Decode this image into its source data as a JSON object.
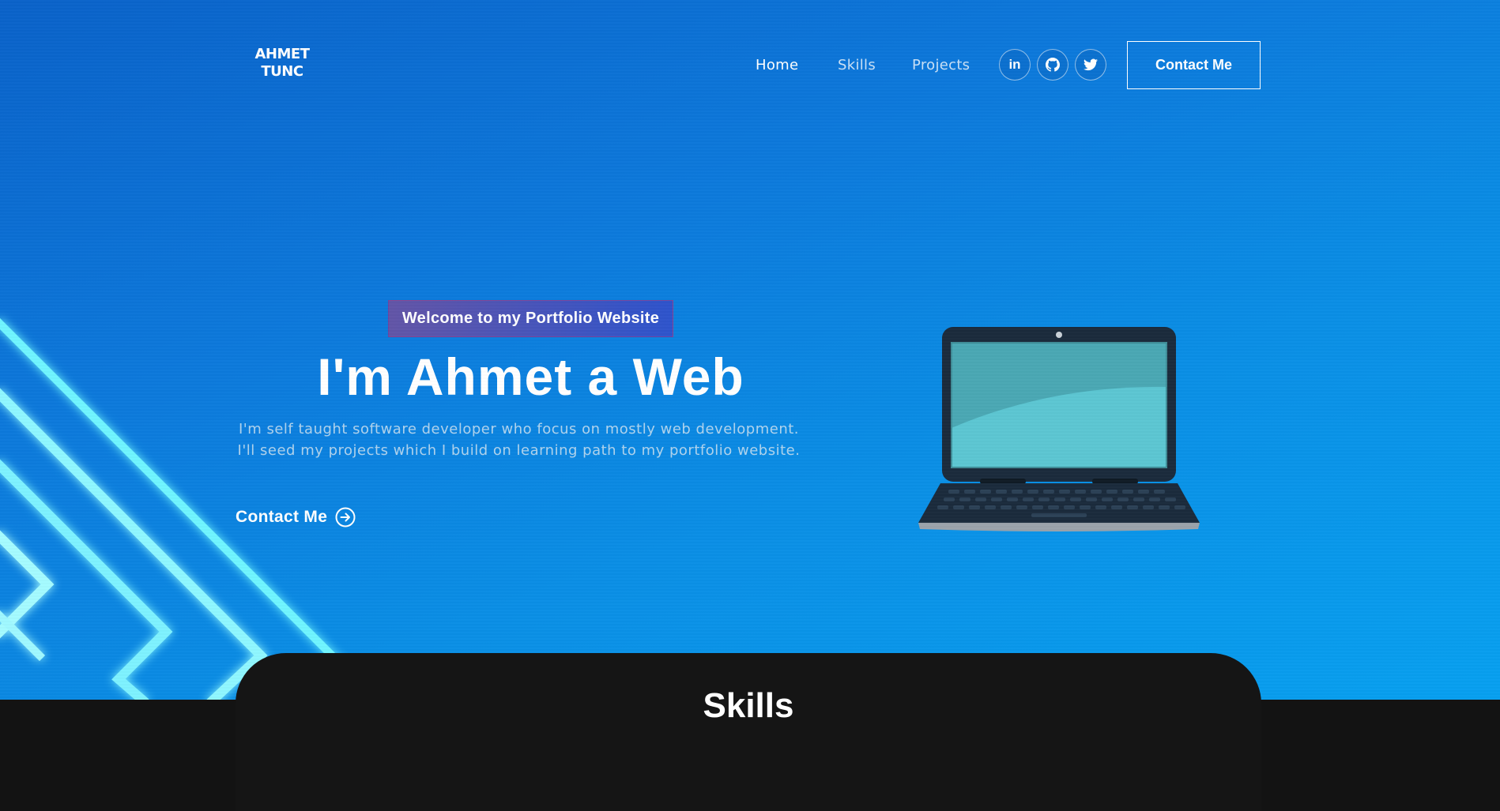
{
  "brand": {
    "line1": "AHMET",
    "line2": "TUNC"
  },
  "nav": {
    "items": [
      {
        "label": "Home",
        "active": true
      },
      {
        "label": "Skills",
        "active": false
      },
      {
        "label": "Projects",
        "active": false
      }
    ],
    "social": [
      {
        "icon": "linkedin-icon",
        "text": "in"
      },
      {
        "icon": "github-icon"
      },
      {
        "icon": "twitter-icon"
      }
    ],
    "contact_label": "Contact Me"
  },
  "hero": {
    "tagline": "Welcome to my Portfolio Website",
    "headline": "I'm Ahmet a Web",
    "description": "I'm self taught software developer who focus on mostly web development. I'll seed my projects which I build on learning path to my portfolio website.",
    "cta_label": "Contact Me",
    "cta_icon": "arrow-right-circle-icon",
    "illustration": "laptop-illustration"
  },
  "skills": {
    "title": "Skills"
  },
  "colors": {
    "hero_gradient_start": "#0a62c9",
    "hero_gradient_end": "#07a0f0",
    "tagline_gradient_start": "#aa367c",
    "tagline_gradient_end": "#4a2fbd",
    "dark_section": "#151515"
  }
}
